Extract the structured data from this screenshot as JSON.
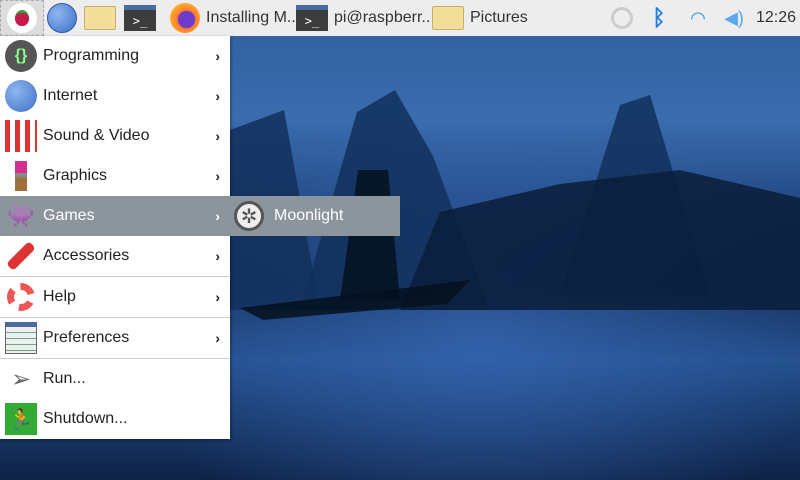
{
  "taskbar": {
    "windows": [
      {
        "label": "Installing M..",
        "icon": "firefox-icon"
      },
      {
        "label": "pi@raspberr..",
        "icon": "terminal-icon"
      },
      {
        "label": "Pictures",
        "icon": "folder-icon"
      }
    ],
    "clock": "12:26"
  },
  "menu": {
    "items": [
      {
        "label": "Programming",
        "icon": "programming-icon",
        "submenu": true
      },
      {
        "label": "Internet",
        "icon": "globe-icon",
        "submenu": true
      },
      {
        "label": "Sound & Video",
        "icon": "sound-video-icon",
        "submenu": true
      },
      {
        "label": "Graphics",
        "icon": "paintbrush-icon",
        "submenu": true
      },
      {
        "label": "Games",
        "icon": "invader-icon",
        "submenu": true
      },
      {
        "label": "Accessories",
        "icon": "knife-icon",
        "submenu": true
      },
      {
        "label": "Help",
        "icon": "lifebuoy-icon",
        "submenu": true
      },
      {
        "label": "Preferences",
        "icon": "sliders-icon",
        "submenu": true
      },
      {
        "label": "Run...",
        "icon": "paper-plane-icon"
      },
      {
        "label": "Shutdown...",
        "icon": "exit-icon"
      }
    ]
  },
  "submenu": {
    "items": [
      {
        "label": "Moonlight",
        "icon": "moonlight-icon"
      }
    ]
  },
  "glyphs": {
    "code": "{}",
    "arrow": "›",
    "term": ">_"
  }
}
